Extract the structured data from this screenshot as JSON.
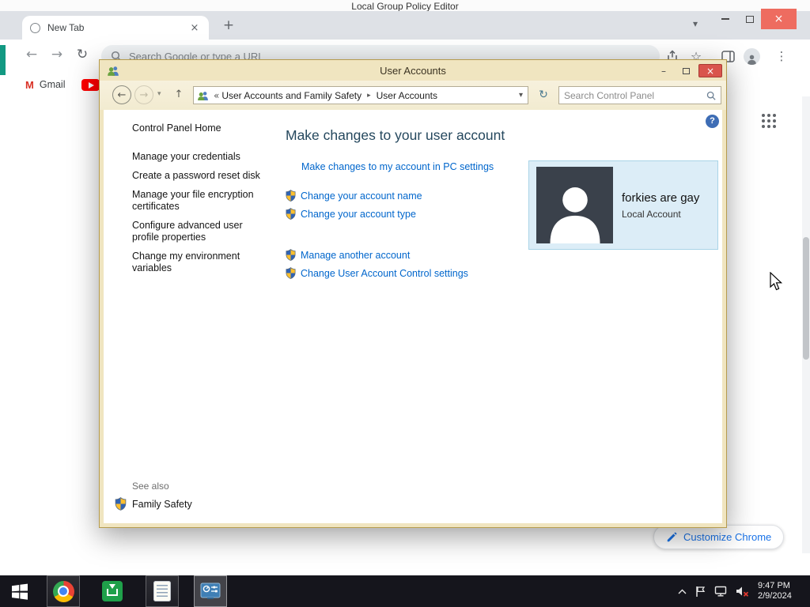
{
  "background_window": {
    "title": "Local Group Policy Editor"
  },
  "chrome": {
    "tab_title": "New Tab",
    "address_placeholder": "Search Google or type a URL",
    "bookmarks": {
      "gmail_label": "Gmail"
    },
    "customize_button_label": "Customize Chrome"
  },
  "user_accounts": {
    "window_title": "User Accounts",
    "breadcrumb": {
      "path_parent": "User Accounts and Family Safety",
      "path_current": "User Accounts"
    },
    "search_placeholder": "Search Control Panel",
    "sidebar": {
      "home": "Control Panel Home",
      "tasks": [
        "Manage your credentials",
        "Create a password reset disk",
        "Manage your file encryption certificates",
        "Configure advanced user profile properties",
        "Change my environment variables"
      ],
      "see_also": "See also",
      "family_safety": "Family Safety"
    },
    "main": {
      "heading": "Make changes to your user account",
      "pc_settings_link": "Make changes to my account in PC settings",
      "links": [
        "Change your account name",
        "Change your account type",
        "Manage another account",
        "Change User Account Control settings"
      ],
      "user_tile": {
        "name": "forkies are gay",
        "account_type": "Local Account"
      }
    }
  },
  "taskbar": {
    "clock_time": "9:47 PM",
    "clock_date": "2/9/2024"
  },
  "colors": {
    "link_blue": "#0066cc",
    "window_frame_gold": "#f0e5c0",
    "close_button_red": "#d9544c",
    "chrome_accent": "#1a73e8",
    "taskbar_dark": "#15151c"
  },
  "icons": {
    "minimize": "–",
    "close": "×",
    "tab_close": "×",
    "new_tab": "+",
    "back": "←",
    "forward": "→",
    "reload": "↻",
    "up": "↑",
    "star": "☆",
    "menu": "⋮",
    "dropdown": "▾",
    "crumb_separator": "▸",
    "breadcrumb_collapsed": "«",
    "help": "?"
  }
}
